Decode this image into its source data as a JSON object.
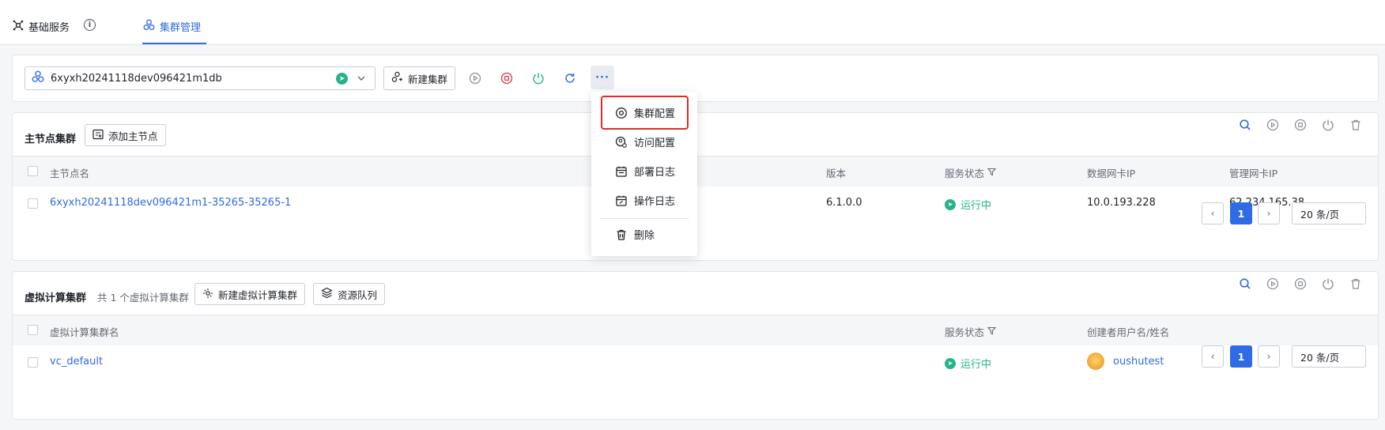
{
  "tabs": {
    "basic_service": "基础服务",
    "cluster_manage": "集群管理"
  },
  "toolbar": {
    "cluster_name": "6xyxh20241118dev096421m1db",
    "new_cluster": "新建集群"
  },
  "dropdown": {
    "items": [
      "集群配置",
      "访问配置",
      "部署日志",
      "操作日志",
      "删除"
    ]
  },
  "master": {
    "title": "主节点集群",
    "add_button": "添加主节点",
    "columns": [
      "主节点名",
      "版本",
      "服务状态",
      "数据网卡IP",
      "管理网卡IP"
    ],
    "rows": [
      {
        "name": "6xyxh20241118dev096421m1-35265-35265-1",
        "version": "6.1.0.0",
        "status": "运行中",
        "data_ip": "10.0.193.228",
        "mgmt_ip": "62.234.165.38"
      }
    ],
    "pager": {
      "current": "1",
      "size": "20 条/页"
    }
  },
  "vc": {
    "title": "虚拟计算集群",
    "count_text": "共 1 个虚拟计算集群",
    "new_button": "新建虚拟计算集群",
    "queue_button": "资源队列",
    "columns": [
      "虚拟计算集群名",
      "服务状态",
      "创建者用户名/姓名"
    ],
    "rows": [
      {
        "name": "vc_default",
        "status": "运行中",
        "creator": "oushutest"
      }
    ],
    "pager": {
      "current": "1",
      "size": "20 条/页"
    }
  },
  "colors": {
    "accent": "#2f6be6",
    "running": "#26b38b",
    "highlight": "#e02b2b"
  }
}
